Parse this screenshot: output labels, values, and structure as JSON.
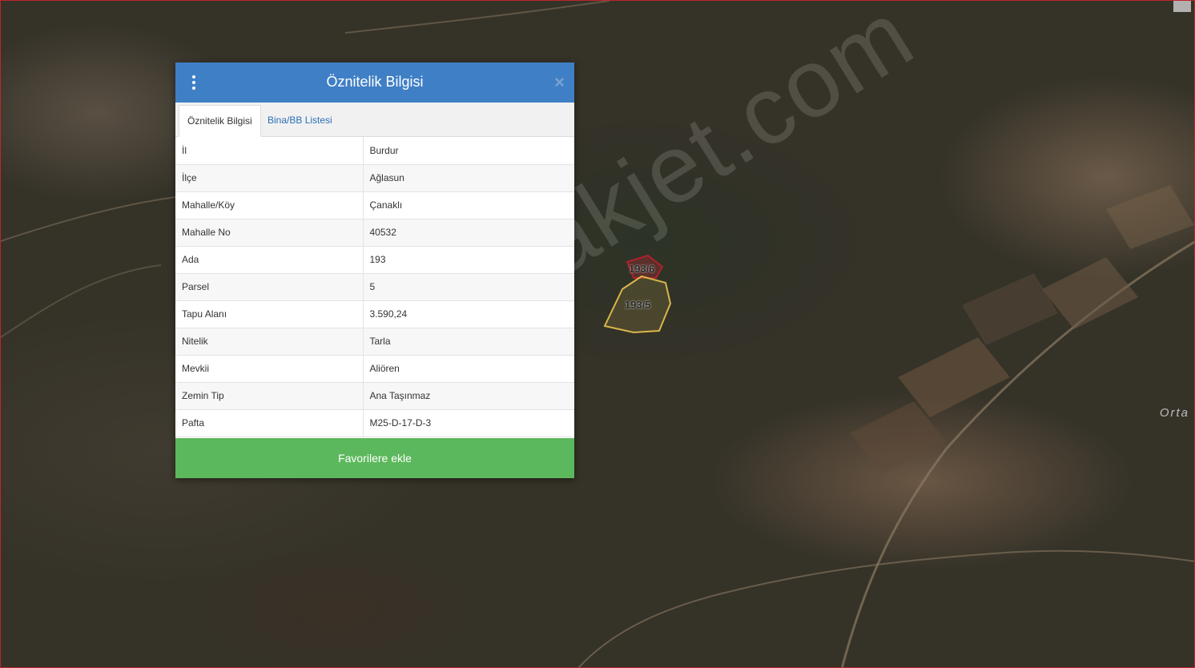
{
  "popup": {
    "title": "Öznitelik Bilgisi",
    "menu_icon": "vertical-ellipsis-icon",
    "close_label": "×",
    "tabs": [
      {
        "label": "Öznitelik Bilgisi",
        "active": true
      },
      {
        "label": "Bina/BB Listesi",
        "active": false
      }
    ],
    "rows": [
      {
        "key": "İl",
        "value": "Burdur"
      },
      {
        "key": "İlçe",
        "value": "Ağlasun"
      },
      {
        "key": "Mahalle/Köy",
        "value": "Çanaklı"
      },
      {
        "key": "Mahalle No",
        "value": "40532"
      },
      {
        "key": "Ada",
        "value": "193"
      },
      {
        "key": "Parsel",
        "value": "5"
      },
      {
        "key": "Tapu Alanı",
        "value": "3.590,24"
      },
      {
        "key": "Nitelik",
        "value": "Tarla"
      },
      {
        "key": "Mevkii",
        "value": "Aliören"
      },
      {
        "key": "Zemin Tip",
        "value": "Ana Taşınmaz"
      },
      {
        "key": "Pafta",
        "value": "M25-D-17-D-3"
      }
    ],
    "favorite_button": "Favorilere ekle"
  },
  "map": {
    "parcels": [
      {
        "label": "193/6"
      },
      {
        "label": "193/5"
      }
    ],
    "place_label": "Orta",
    "watermark": "emlakjet.com"
  },
  "colors": {
    "header": "#3f7fc6",
    "favorite_button": "#5cb85c",
    "tab_link": "#2d6fb5",
    "map_border": "#c0242c"
  }
}
